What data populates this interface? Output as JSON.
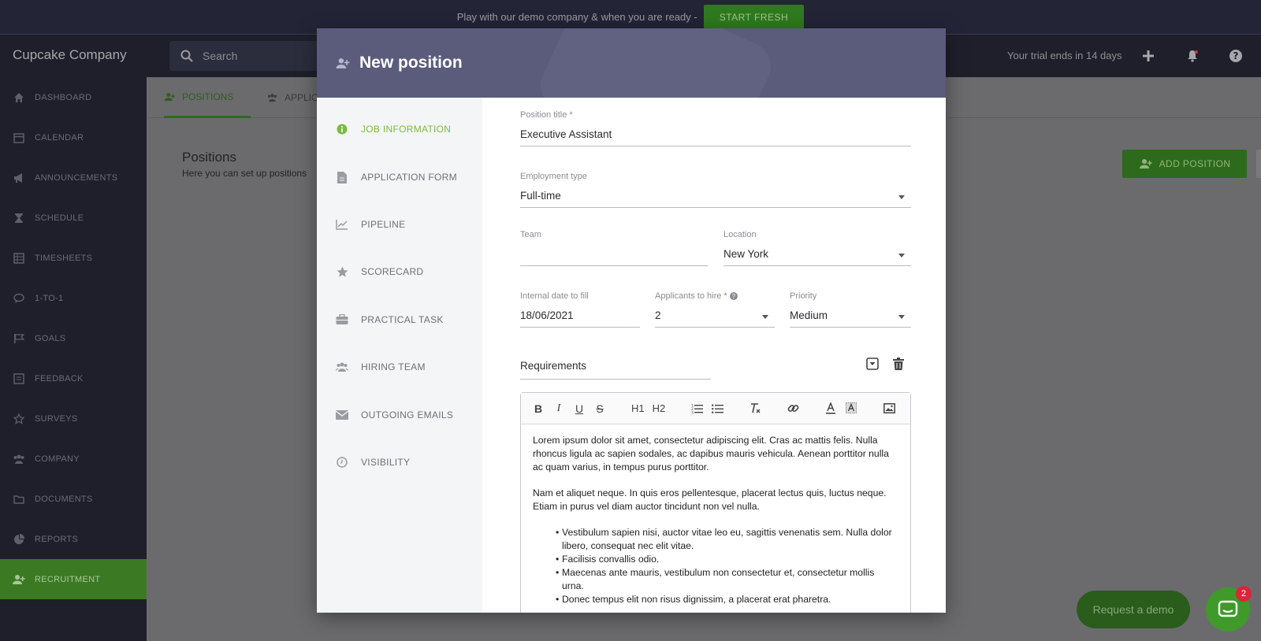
{
  "banner": {
    "text": "Play with our demo company & when you are ready -",
    "button": "START FRESH"
  },
  "header": {
    "brand": "Cupcake Company",
    "search_placeholder": "Search",
    "trial": "Your trial ends in 14 days"
  },
  "sidebar": {
    "items": [
      {
        "label": "DASHBOARD",
        "icon": "home-icon"
      },
      {
        "label": "CALENDAR",
        "icon": "calendar-icon"
      },
      {
        "label": "ANNOUNCEMENTS",
        "icon": "megaphone-icon"
      },
      {
        "label": "SCHEDULE",
        "icon": "hourglass-icon"
      },
      {
        "label": "TIMESHEETS",
        "icon": "grid-icon"
      },
      {
        "label": "1-TO-1",
        "icon": "chat-icon"
      },
      {
        "label": "GOALS",
        "icon": "flag-icon"
      },
      {
        "label": "FEEDBACK",
        "icon": "feedback-icon"
      },
      {
        "label": "SURVEYS",
        "icon": "star-icon"
      },
      {
        "label": "COMPANY",
        "icon": "users-icon"
      },
      {
        "label": "DOCUMENTS",
        "icon": "folder-icon"
      },
      {
        "label": "REPORTS",
        "icon": "pie-icon"
      },
      {
        "label": "RECRUITMENT",
        "icon": "add-user-icon",
        "active": true
      }
    ]
  },
  "main": {
    "tabs": [
      "POSITIONS",
      "APPLIC"
    ],
    "title": "Positions",
    "subtitle": "Here you can set up positions",
    "add_button": "ADD POSITION",
    "demo_button": "Request a demo",
    "chat_badge": "2"
  },
  "modal": {
    "title": "New position",
    "nav": [
      {
        "label": "JOB INFORMATION",
        "icon": "info-icon",
        "active": true
      },
      {
        "label": "APPLICATION FORM",
        "icon": "document-icon"
      },
      {
        "label": "PIPELINE",
        "icon": "chart-line-icon"
      },
      {
        "label": "SCORECARD",
        "icon": "star-icon"
      },
      {
        "label": "PRACTICAL TASK",
        "icon": "briefcase-icon"
      },
      {
        "label": "HIRING TEAM",
        "icon": "users-icon"
      },
      {
        "label": "OUTGOING EMAILS",
        "icon": "envelope-icon"
      },
      {
        "label": "VISIBILITY",
        "icon": "clock-icon"
      }
    ],
    "form": {
      "position_title_label": "Position title *",
      "position_title": "Executive Assistant",
      "employment_type_label": "Employment type",
      "employment_type": "Full-time",
      "team_label": "Team",
      "team": "",
      "location_label": "Location",
      "location": "New York",
      "date_label": "Internal date to fill",
      "date": "18/06/2021",
      "applicants_label": "Applicants to hire *",
      "applicants": "2",
      "priority_label": "Priority",
      "priority": "Medium",
      "section_title": "Requirements"
    },
    "editor": {
      "toolbar": {
        "bold": "B",
        "italic": "I",
        "underline": "U",
        "strike": "S",
        "h1": "H1",
        "h2": "H2"
      },
      "p1": "Lorem ipsum dolor sit amet, consectetur adipiscing elit. Cras ac mattis felis. Nulla rhoncus ligula ac sapien sodales, ac dapibus mauris vehicula. Aenean porttitor nulla ac quam varius, in tempus purus porttitor.",
      "p2": "Nam et aliquet neque. In quis eros pellentesque, placerat lectus quis, luctus neque. Etiam in purus vel diam auctor tincidunt non vel nulla.",
      "bullets": [
        "Vestibulum sapien nisi, auctor vitae leo eu, sagittis venenatis sem. Nulla dolor libero, consequat nec elit vitae.",
        "Facilisis convallis odio.",
        "Maecenas ante mauris, vestibulum non consectetur et, consectetur mollis urna.",
        "Donec tempus elit non risus dignissim, a placerat erat pharetra."
      ]
    }
  }
}
